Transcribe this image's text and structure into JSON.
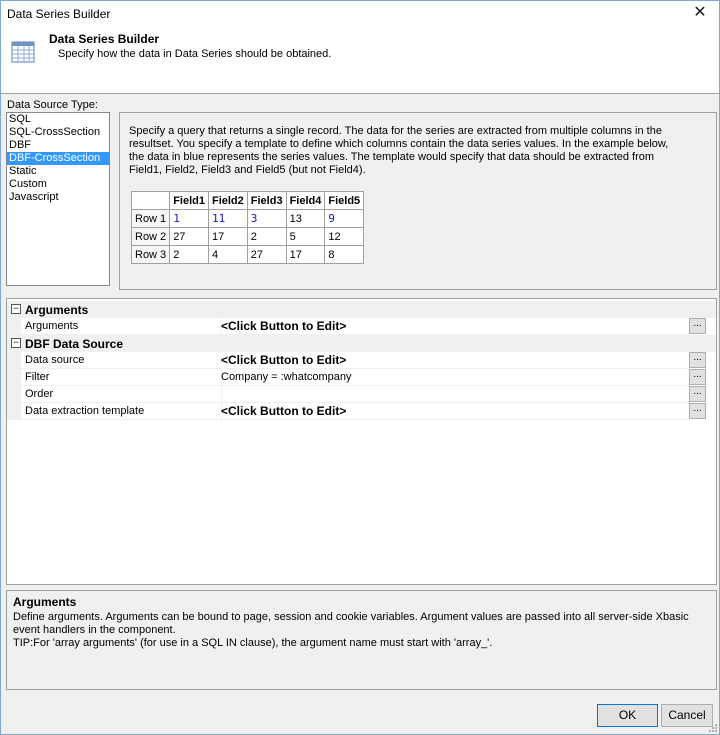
{
  "window": {
    "title": "Data Series Builder",
    "close_glyph": "✕"
  },
  "header": {
    "title": "Data Series Builder",
    "subtitle": "Specify how the data in Data Series should be obtained.",
    "icon": "table-icon"
  },
  "data_source": {
    "label": "Data Source Type:",
    "items": [
      "SQL",
      "SQL-CrossSection",
      "DBF",
      "DBF-CrossSection",
      "Static",
      "Custom",
      "Javascript"
    ],
    "selected": "DBF-CrossSection"
  },
  "description": {
    "text": "Specify a query that returns a single record. The data for the series are extracted from multiple columns in the resultset. You specify a template to define which columns contain the data series values. In the example below, the data in blue represents the series values. The template would specify that data should be extracted from Field1, Field2, Field3 and Field5 (but not Field4).",
    "table": {
      "headers": [
        "",
        "Field1",
        "Field2",
        "Field3",
        "Field4",
        "Field5"
      ],
      "rows": [
        [
          "Row 1",
          "1",
          "11",
          "3",
          "13",
          "9"
        ],
        [
          "Row 2",
          "27",
          "17",
          "2",
          "5",
          "12"
        ],
        [
          "Row 3",
          "2",
          "4",
          "27",
          "17",
          "8"
        ]
      ]
    }
  },
  "properties": {
    "groups": [
      {
        "title": "Arguments",
        "toggle": "−",
        "rows": [
          {
            "name": "Arguments",
            "value": "<Click Button to Edit>",
            "button": "..."
          }
        ]
      },
      {
        "title": "DBF Data Source",
        "toggle": "−",
        "rows": [
          {
            "name": "Data source",
            "value": "<Click Button to Edit>",
            "button": "..."
          },
          {
            "name": "Filter",
            "value": "Company =  :whatcompany",
            "button": "..."
          },
          {
            "name": "Order",
            "value": "",
            "button": "..."
          },
          {
            "name": "Data extraction template",
            "value": "<Click Button to Edit>",
            "button": "..."
          }
        ]
      }
    ]
  },
  "help": {
    "title": "Arguments",
    "line1": "Define arguments. Arguments can be bound to page, session and cookie variables. Argument values are passed into all server-side Xbasic event handlers in the component.",
    "line2": "TIP:For 'array arguments' (for use in a SQL IN clause), the argument name must start with 'array_'."
  },
  "buttons": {
    "ok": "OK",
    "cancel": "Cancel"
  },
  "colors": {
    "selected": "#3399ff",
    "series_value": "#1414c8",
    "focus": "#0078d7"
  }
}
